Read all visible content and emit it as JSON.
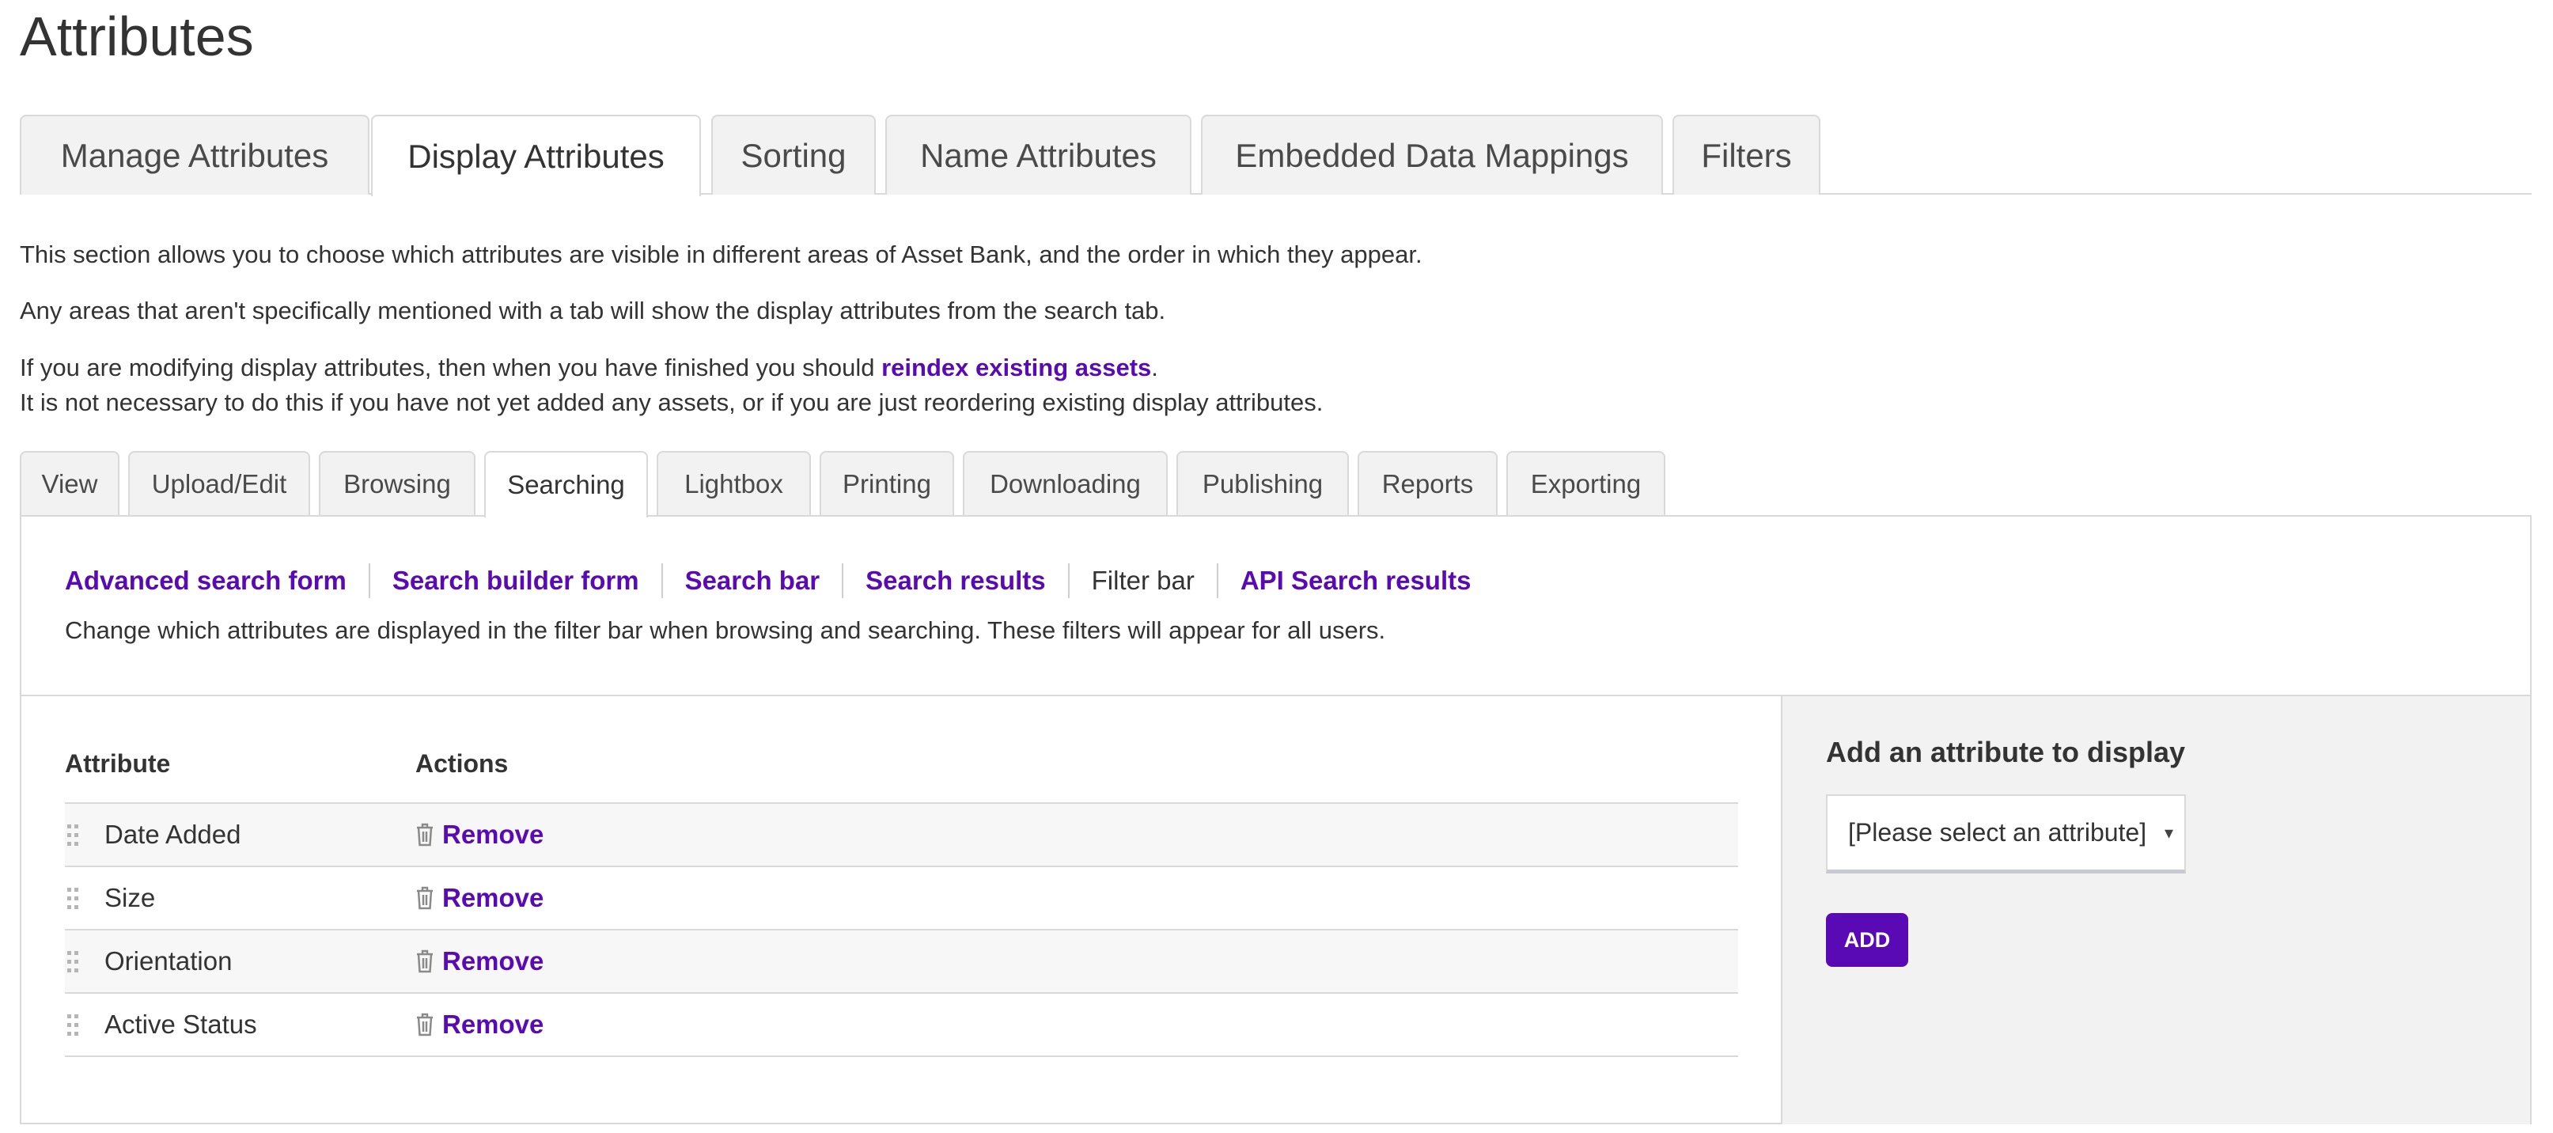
{
  "page": {
    "title": "Attributes"
  },
  "main_tabs": [
    {
      "label": "Manage Attributes"
    },
    {
      "label": "Display Attributes"
    },
    {
      "label": "Sorting"
    },
    {
      "label": "Name Attributes"
    },
    {
      "label": "Embedded Data Mappings"
    },
    {
      "label": "Filters"
    }
  ],
  "intro": {
    "line1": "This section allows you to choose which attributes are visible in different areas of Asset Bank, and the order in which they appear.",
    "line2": "Any areas that aren't specifically mentioned with a tab will show the display attributes from the search tab.",
    "line3_prefix": "If you are modifying display attributes, then when you have finished you should ",
    "line3_link": "reindex existing assets",
    "line3_suffix": ".",
    "line4": "It is not necessary to do this if you have not yet added any assets, or if you are just reordering existing display attributes."
  },
  "sub_tabs": [
    {
      "label": "View"
    },
    {
      "label": "Upload/Edit"
    },
    {
      "label": "Browsing"
    },
    {
      "label": "Searching"
    },
    {
      "label": "Lightbox"
    },
    {
      "label": "Printing"
    },
    {
      "label": "Downloading"
    },
    {
      "label": "Publishing"
    },
    {
      "label": "Reports"
    },
    {
      "label": "Exporting"
    }
  ],
  "search_links": [
    {
      "label": "Advanced search form"
    },
    {
      "label": "Search builder form"
    },
    {
      "label": "Search bar"
    },
    {
      "label": "Search results"
    },
    {
      "label": "Filter bar"
    },
    {
      "label": "API Search results"
    }
  ],
  "panel": {
    "description": "Change which attributes are displayed in the filter bar when browsing and searching. These filters will appear for all users."
  },
  "table": {
    "headers": {
      "attribute": "Attribute",
      "actions": "Actions"
    },
    "rows": [
      {
        "name": "Date Added",
        "action": "Remove"
      },
      {
        "name": "Size",
        "action": "Remove"
      },
      {
        "name": "Orientation",
        "action": "Remove"
      },
      {
        "name": "Active Status",
        "action": "Remove"
      }
    ]
  },
  "add_panel": {
    "title": "Add an attribute to display",
    "select_value": "[Please select an attribute]",
    "button_label": "ADD"
  },
  "colors": {
    "link": "#5a0ab4",
    "button_bg": "#5a0ab4",
    "tab_bg": "#f2f2f2",
    "border": "#d9d9d9"
  },
  "icons": [
    "drag-handle-icon",
    "trash-icon",
    "select-arrow-icon"
  ]
}
